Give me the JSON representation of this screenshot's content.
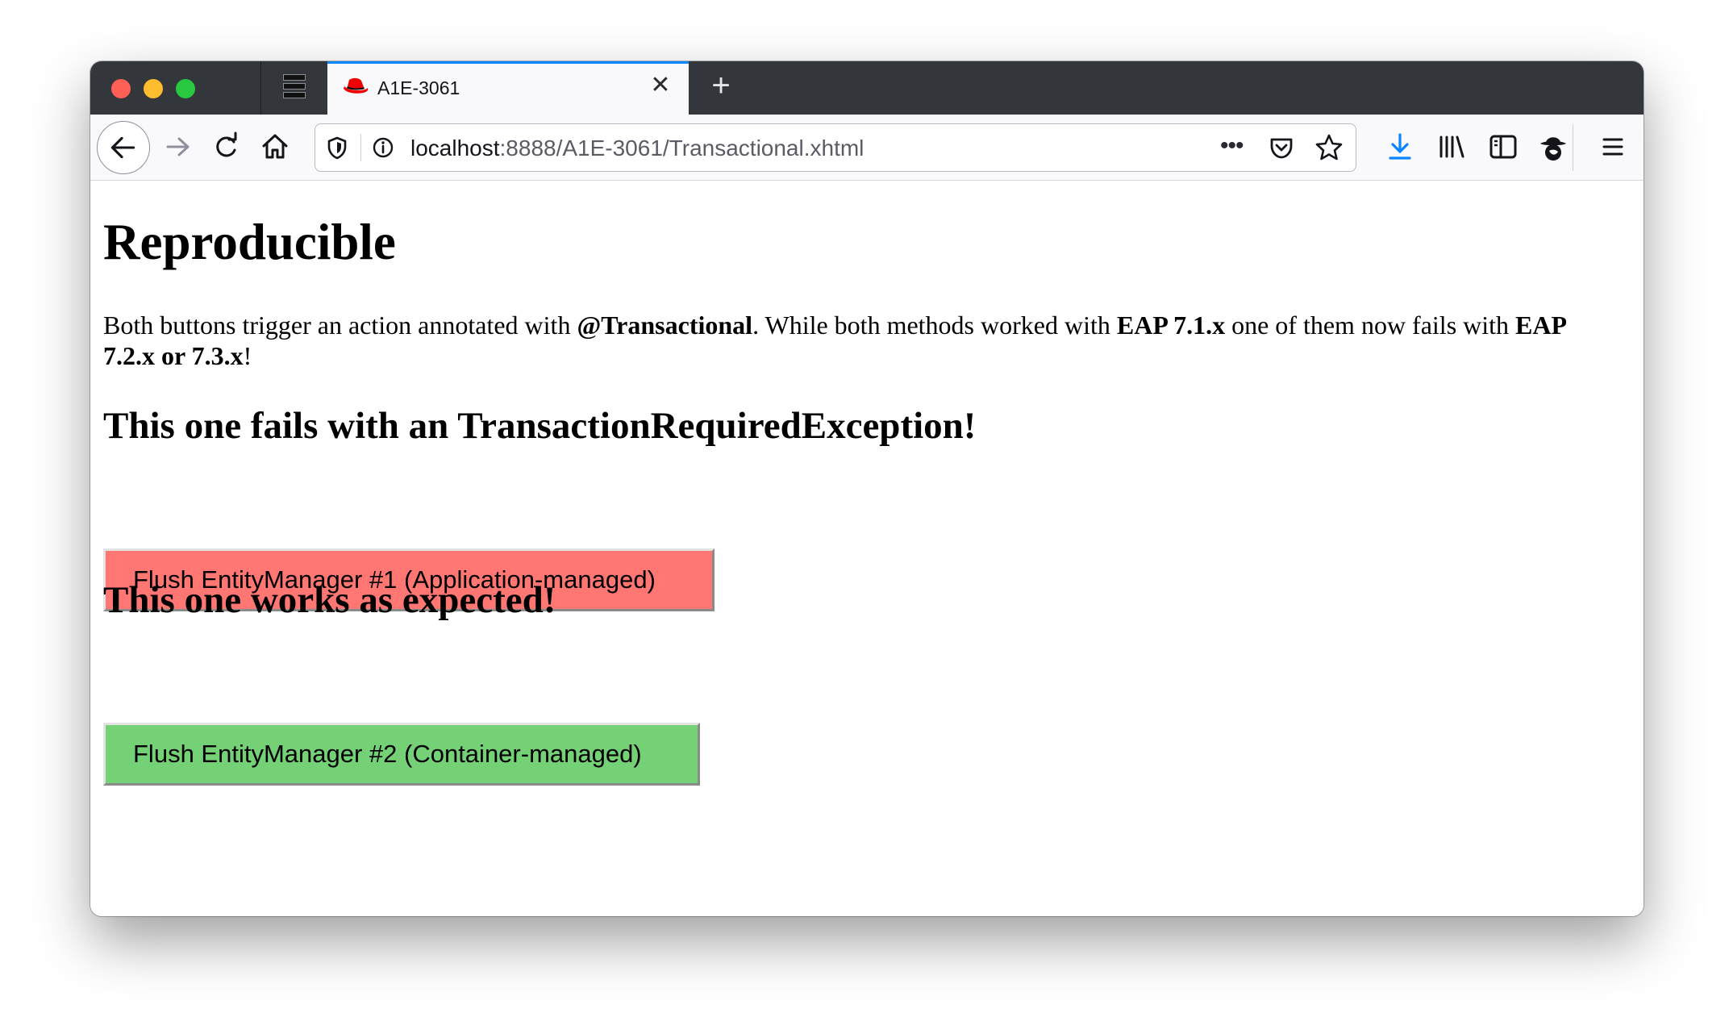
{
  "browser": {
    "tab": {
      "title": "A1E-3061",
      "favicon": "red-hat-icon",
      "close_icon": "close-icon"
    },
    "new_tab_icon": "plus-icon",
    "url": {
      "host": "localhost",
      "rest": ":8888/A1E-3061/Transactional.xhtml"
    },
    "accent_color": "#0a84ff"
  },
  "page": {
    "heading": "Reproducible",
    "intro": {
      "part1": "Both buttons trigger an action annotated with ",
      "bold1": "@Transactional",
      "part2": ". While both methods worked with ",
      "bold2": "EAP 7.1.x",
      "part3": " one of them now fails with ",
      "bold3": "EAP 7.2.x or 7.3.x",
      "part4": "!"
    },
    "section_fail": {
      "heading": "This one fails with an TransactionRequiredException!",
      "button_label": "Flush EntityManager #1 (Application-managed)",
      "button_color": "#ff7672"
    },
    "section_ok": {
      "heading": "This one works as expected!",
      "button_label": "Flush EntityManager #2 (Container-managed)",
      "button_color": "#74d176"
    }
  }
}
